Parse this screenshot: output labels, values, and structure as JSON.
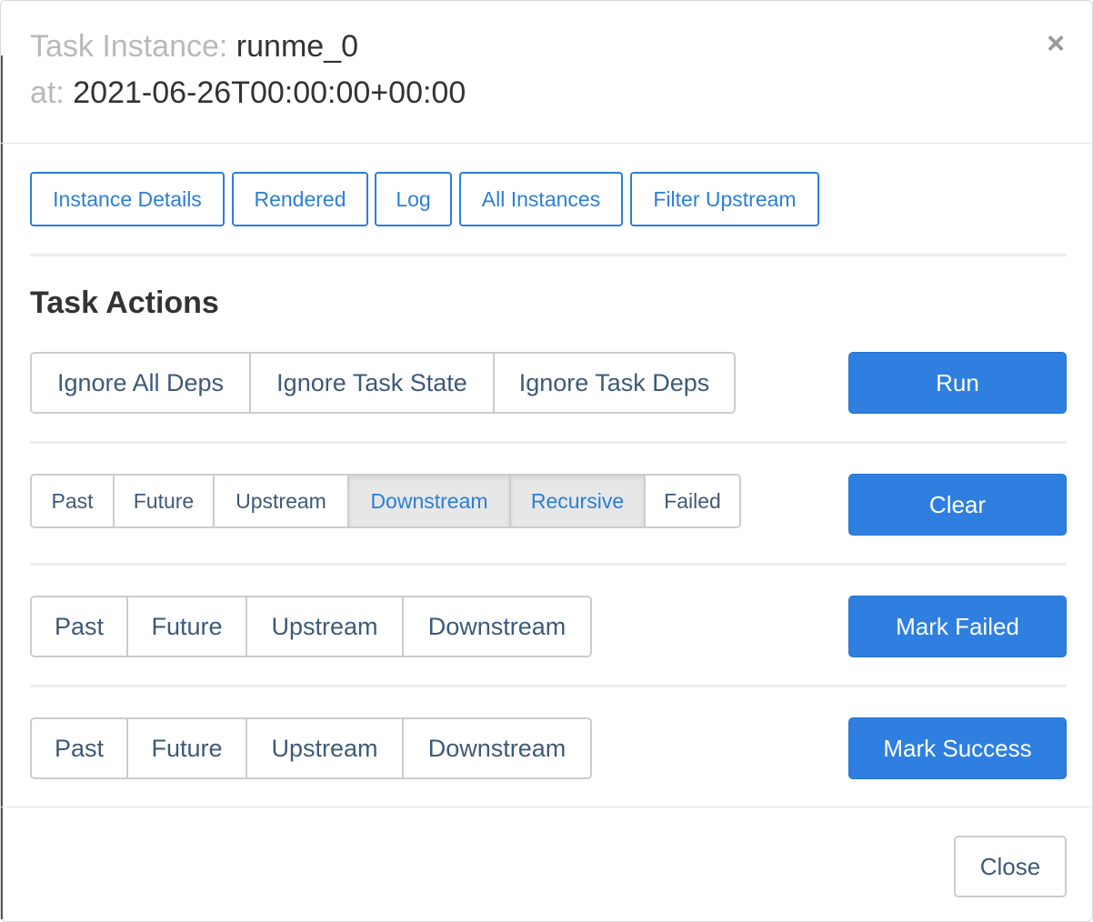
{
  "header": {
    "task_label": "Task Instance:",
    "task_value": "runme_0",
    "at_label": "at:",
    "at_value": "2021-06-26T00:00:00+00:00",
    "close_icon": "close-icon"
  },
  "links": [
    "Instance Details",
    "Rendered",
    "Log",
    "All Instances",
    "Filter Upstream"
  ],
  "section_title": "Task Actions",
  "run_row": {
    "options": [
      "Ignore All Deps",
      "Ignore Task State",
      "Ignore Task Deps"
    ],
    "button": "Run"
  },
  "clear_row": {
    "options": [
      "Past",
      "Future",
      "Upstream",
      "Downstream",
      "Recursive",
      "Failed"
    ],
    "active": [
      "Downstream",
      "Recursive"
    ],
    "button": "Clear"
  },
  "mark_failed_row": {
    "options": [
      "Past",
      "Future",
      "Upstream",
      "Downstream"
    ],
    "button": "Mark Failed"
  },
  "mark_success_row": {
    "options": [
      "Past",
      "Future",
      "Upstream",
      "Downstream"
    ],
    "button": "Mark Success"
  },
  "footer": {
    "close_label": "Close"
  },
  "colors": {
    "primary": "#2e7fe0",
    "link": "#2a7fd8",
    "active_bg": "#e7e7e7"
  }
}
